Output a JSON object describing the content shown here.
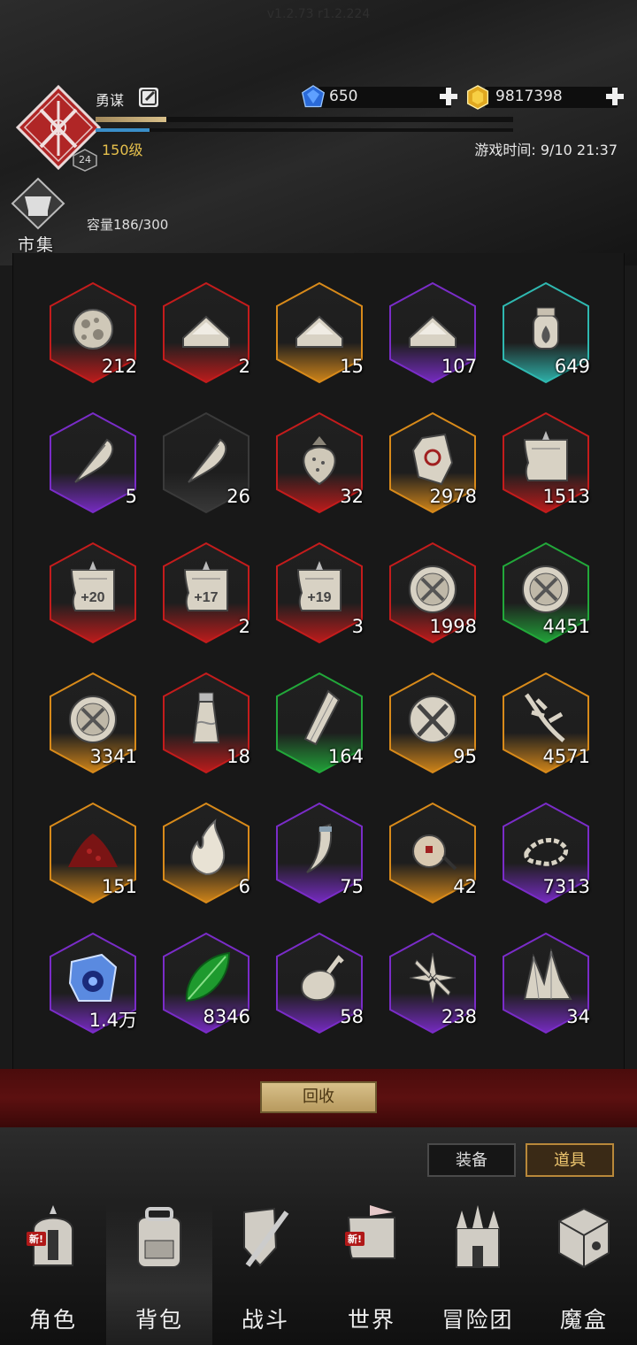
{
  "version": "v1.2.73 r1.2.224",
  "player": {
    "name": "勇谋",
    "level_label": "150级",
    "avatar_level": "24",
    "xp_fraction": 0.17,
    "mp_fraction": 0.13
  },
  "currency": {
    "gems": "650",
    "gold": "9817398"
  },
  "game_time": "游戏时间: 9/10 21:37",
  "market_label": "市集",
  "capacity": "容量186/300",
  "items": [
    {
      "count": "212",
      "rarity": "red",
      "icon": "moon-stone-icon"
    },
    {
      "count": "2",
      "rarity": "red",
      "icon": "powder-icon"
    },
    {
      "count": "15",
      "rarity": "orange",
      "icon": "powder-icon"
    },
    {
      "count": "107",
      "rarity": "purple",
      "icon": "powder-icon"
    },
    {
      "count": "649",
      "rarity": "teal",
      "icon": "fire-jar-icon"
    },
    {
      "count": "5",
      "rarity": "purple",
      "icon": "feather-icon"
    },
    {
      "count": "26",
      "rarity": "gray",
      "icon": "feather-icon"
    },
    {
      "count": "32",
      "rarity": "red",
      "icon": "strawberry-icon"
    },
    {
      "count": "2978",
      "rarity": "orange",
      "icon": "rune-stone-icon"
    },
    {
      "count": "1513",
      "rarity": "red",
      "icon": "scroll-icon"
    },
    {
      "count": "",
      "rarity": "red",
      "icon": "scroll-icon",
      "label": "+20"
    },
    {
      "count": "2",
      "rarity": "red",
      "icon": "scroll-icon",
      "label": "+17"
    },
    {
      "count": "3",
      "rarity": "red",
      "icon": "scroll-icon",
      "label": "+19"
    },
    {
      "count": "1998",
      "rarity": "red",
      "icon": "medal-icon"
    },
    {
      "count": "4451",
      "rarity": "green",
      "icon": "medal-icon"
    },
    {
      "count": "3341",
      "rarity": "orange",
      "icon": "medal-icon"
    },
    {
      "count": "18",
      "rarity": "red",
      "icon": "bottle-icon"
    },
    {
      "count": "164",
      "rarity": "green",
      "icon": "crystal-shard-icon"
    },
    {
      "count": "95",
      "rarity": "orange",
      "icon": "crossed-tools-icon"
    },
    {
      "count": "4571",
      "rarity": "orange",
      "icon": "root-branch-icon"
    },
    {
      "count": "151",
      "rarity": "orange",
      "icon": "red-dust-icon"
    },
    {
      "count": "6",
      "rarity": "orange",
      "icon": "flame-icon"
    },
    {
      "count": "75",
      "rarity": "purple",
      "icon": "fang-icon"
    },
    {
      "count": "42",
      "rarity": "orange",
      "icon": "pouch-icon"
    },
    {
      "count": "7313",
      "rarity": "purple",
      "icon": "ash-icon"
    },
    {
      "count": "1.4万",
      "rarity": "purple",
      "icon": "blue-cube-icon"
    },
    {
      "count": "8346",
      "rarity": "purple",
      "icon": "green-leaf-icon"
    },
    {
      "count": "58",
      "rarity": "purple",
      "icon": "meat-icon"
    },
    {
      "count": "238",
      "rarity": "purple",
      "icon": "star-burst-icon"
    },
    {
      "count": "34",
      "rarity": "purple",
      "icon": "crystal-cluster-icon"
    }
  ],
  "recycle_label": "回收",
  "tabs": {
    "equip": "装备",
    "items": "道具"
  },
  "nav": [
    {
      "label": "角色",
      "icon": "helmet-icon",
      "new": true
    },
    {
      "label": "背包",
      "icon": "backpack-icon",
      "new": false,
      "selected": true
    },
    {
      "label": "战斗",
      "icon": "shield-sword-icon",
      "new": false
    },
    {
      "label": "世界",
      "icon": "map-scroll-icon",
      "new": true
    },
    {
      "label": "冒险团",
      "icon": "castle-icon",
      "new": false
    },
    {
      "label": "魔盒",
      "icon": "magic-box-icon",
      "new": false
    }
  ],
  "new_tag": "新!",
  "colors": {
    "red": "#c41c1c",
    "orange": "#d88a1a",
    "purple": "#7a2cc8",
    "teal": "#2fb8b0",
    "green": "#22a83a",
    "gray": "#3a3a3a",
    "gold_text": "#e6c04c"
  }
}
